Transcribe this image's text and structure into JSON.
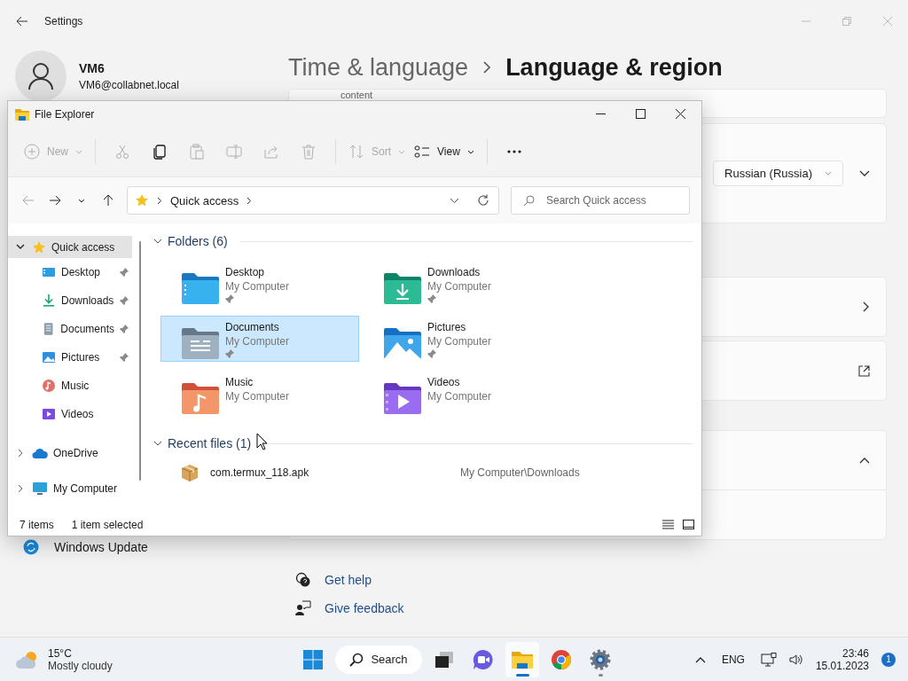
{
  "settings": {
    "title": "Settings",
    "user": {
      "name": "VM6",
      "email": "VM6@collabnet.local"
    },
    "breadcrumb": [
      {
        "label": "Time & language",
        "current": false
      },
      {
        "label": "Language & region",
        "current": true
      }
    ],
    "cut_text": "content",
    "cards": [
      {
        "kind": "blank"
      },
      {
        "kind": "dropdown",
        "value": "Russian (Russia)"
      },
      {
        "kind": "chevron-right"
      },
      {
        "kind": "external"
      },
      {
        "kind": "chevron-up"
      },
      {
        "kind": "blank"
      }
    ],
    "nav": [
      {
        "label": "Windows Update",
        "kind": "update"
      }
    ],
    "links": [
      {
        "kind": "help",
        "label": "Get help"
      },
      {
        "kind": "feedback",
        "label": "Give feedback"
      }
    ]
  },
  "explorer": {
    "title": "File Explorer",
    "toolbar": [
      [
        {
          "kind": "new",
          "label": "New",
          "disabled": true,
          "menu": true
        }
      ],
      [
        {
          "kind": "cut",
          "disabled": true,
          "menu": false
        },
        {
          "kind": "copy",
          "disabled": false,
          "menu": false
        },
        {
          "kind": "paste",
          "disabled": true,
          "menu": false
        },
        {
          "kind": "rename",
          "disabled": true,
          "menu": false
        },
        {
          "kind": "share",
          "disabled": true,
          "menu": false
        },
        {
          "kind": "delete",
          "disabled": true,
          "menu": false
        }
      ],
      [
        {
          "kind": "sort",
          "label": "Sort",
          "disabled": true,
          "menu": true
        },
        {
          "kind": "view",
          "label": "View",
          "disabled": false,
          "menu": true
        }
      ],
      [
        {
          "kind": "more",
          "disabled": false,
          "menu": false
        }
      ]
    ],
    "nav_buttons": [
      {
        "kind": "back",
        "disabled": true
      },
      {
        "kind": "forward",
        "disabled": false
      },
      {
        "kind": "recent",
        "disabled": false
      },
      {
        "kind": "up",
        "disabled": false
      }
    ],
    "address": {
      "path": [
        "Quick access"
      ]
    },
    "search": {
      "placeholder": "Search Quick access"
    },
    "tree": [
      {
        "label": "Quick access",
        "kind": "star",
        "expanded": true,
        "selected": true,
        "children": [
          {
            "label": "Desktop",
            "kind": "desktop",
            "pinned": true,
            "selected": false
          },
          {
            "label": "Downloads",
            "kind": "downloads",
            "pinned": true,
            "selected": false
          },
          {
            "label": "Documents",
            "kind": "documents",
            "pinned": true,
            "selected": false
          },
          {
            "label": "Pictures",
            "kind": "pictures",
            "pinned": true,
            "selected": false
          },
          {
            "label": "Music",
            "kind": "music",
            "pinned": false,
            "selected": false
          },
          {
            "label": "Videos",
            "kind": "videos",
            "pinned": false,
            "selected": false
          }
        ]
      },
      {
        "label": "OneDrive",
        "kind": "cloud",
        "expanded": false,
        "selected": false
      },
      {
        "label": "My Computer",
        "kind": "computer",
        "expanded": false,
        "selected": false
      }
    ],
    "folders": {
      "title": "Folders (6)",
      "expanded": true,
      "items": [
        {
          "name": "Desktop",
          "kind": "desktop",
          "location": "My Computer",
          "pinned": true,
          "selected": false
        },
        {
          "name": "Downloads",
          "kind": "downloads",
          "location": "My Computer",
          "pinned": true,
          "selected": false
        },
        {
          "name": "Documents",
          "kind": "documents",
          "location": "My Computer",
          "pinned": true,
          "selected": true
        },
        {
          "name": "Pictures",
          "kind": "pictures",
          "location": "My Computer",
          "pinned": true,
          "selected": false
        },
        {
          "name": "Music",
          "kind": "music",
          "location": "My Computer",
          "pinned": false,
          "selected": false
        },
        {
          "name": "Videos",
          "kind": "videos",
          "location": "My Computer",
          "pinned": false,
          "selected": false
        }
      ]
    },
    "recent": {
      "title": "Recent files (1)",
      "expanded": true,
      "files": [
        {
          "name": "com.termux_118.apk",
          "path": "My Computer\\Downloads"
        }
      ]
    },
    "status": {
      "count": "7 items",
      "selection": "1 item selected"
    }
  },
  "taskbar": {
    "weather": {
      "temp": "15°C",
      "condition": "Mostly cloudy"
    },
    "apps": [
      {
        "kind": "start",
        "active": false,
        "running": false
      },
      {
        "kind": "search",
        "label": "Search",
        "active": false,
        "running": false
      },
      {
        "kind": "taskview",
        "active": false,
        "running": false
      },
      {
        "kind": "chat",
        "active": false,
        "running": false
      },
      {
        "kind": "explorer",
        "active": true,
        "running": true
      },
      {
        "kind": "chrome",
        "active": false,
        "running": false
      },
      {
        "kind": "settings",
        "active": false,
        "running": true
      }
    ],
    "language": "ENG",
    "time": "23:46",
    "date": "15.01.2023",
    "notifications": "1"
  }
}
